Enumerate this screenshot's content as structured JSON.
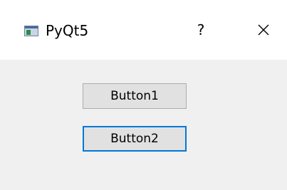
{
  "window": {
    "title": "PyQt5",
    "help_label": "?",
    "app_icon": "pyqt-window-icon",
    "close_icon": "close-icon"
  },
  "buttons": {
    "button1_label": "Button1",
    "button2_label": "Button2"
  },
  "colors": {
    "focus_border": "#0078d7",
    "button_face": "#e1e1e1",
    "window_background": "#f0f0f0",
    "titlebar_background": "#ffffff"
  }
}
